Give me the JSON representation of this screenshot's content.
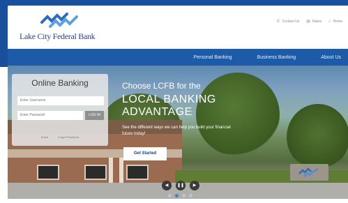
{
  "brand": {
    "name": "Lake City Federal Bank"
  },
  "utility_links": [
    {
      "label": "Contact Us",
      "icon": "phone-icon"
    },
    {
      "label": "Rates",
      "icon": "rates-icon"
    },
    {
      "label": "Home",
      "icon": "home-icon"
    }
  ],
  "nav": {
    "items": [
      {
        "label": "Personal Banking"
      },
      {
        "label": "Business Banking"
      },
      {
        "label": "About Us"
      }
    ]
  },
  "login": {
    "title": "Online Banking",
    "username_placeholder": "Enter Username",
    "password_placeholder": "Enter Password",
    "button_label": "LOG IN",
    "links": [
      "Enroll",
      "Forgot Password"
    ]
  },
  "hero": {
    "line1": "Choose LCFB for the",
    "line2": "LOCAL BANKING",
    "line3": "ADVANTAGE",
    "subtext": "See the different ways we can help you build your financial future today!",
    "cta_label": "Get Started"
  },
  "carousel": {
    "controls": [
      "prev",
      "pause",
      "next"
    ],
    "slide_count": 4,
    "active_index": 1
  },
  "colors": {
    "brand_blue": "#1a4f9c",
    "nav_blue": "#1d5aa8",
    "logo_text": "#2a3f8f"
  }
}
